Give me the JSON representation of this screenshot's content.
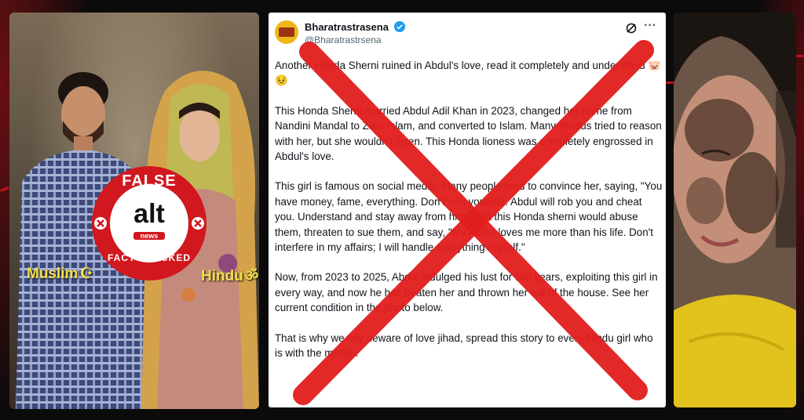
{
  "left_image": {
    "badge": {
      "false_label": "FALSE",
      "brand": "alt",
      "brand_sub": "news",
      "fact_checked_label": "FACT-CHECKED"
    },
    "caption_left": "Muslim",
    "caption_left_symbol": "☪",
    "caption_right": "Hindu",
    "caption_right_symbol": "ॐ"
  },
  "tweet": {
    "display_name": "Bharatrastrasena",
    "handle": "@Bharatrastrsena",
    "icons": [
      "verified-icon",
      "grok-icon",
      "more-icon"
    ],
    "paragraphs": [
      "Another Honda Sherni ruined in Abdul's love, read it completely and understand 🐷😣",
      "This Honda Sherni married Abdul Adil Khan in 2023, changed her name from Nandini Mandal to Zara Islam, and converted to Islam. Many Hindus tried to reason with her, but she wouldn't listen. This Honda lioness was completely engrossed in Abdul's love.",
      "This girl is famous on social media. Many people tried to convince her, saying, \"You have money, fame, everything. Don't ruin yourself. Abdul will rob you and cheat you. Understand and stay away from him.\" But this Honda sherni would abuse them, threaten to sue them, and say, \"My Abdul loves me more than his life. Don't interfere in my affairs; I will handle everything myself.\"",
      "Now, from 2023 to 2025, Abdul indulged his lust for two years, exploiting this girl in every way, and now he has beaten her and thrown her out of the house. See her current condition in the photo below.",
      "That is why we say beware of love jihad, spread this story to every Hindu girl who is with the mullah."
    ]
  },
  "colors": {
    "cross_red": "#e21d1d",
    "caption_yellow": "#f4e04d",
    "badge_red": "#d1181f",
    "verified_blue": "#1d9bf0"
  }
}
